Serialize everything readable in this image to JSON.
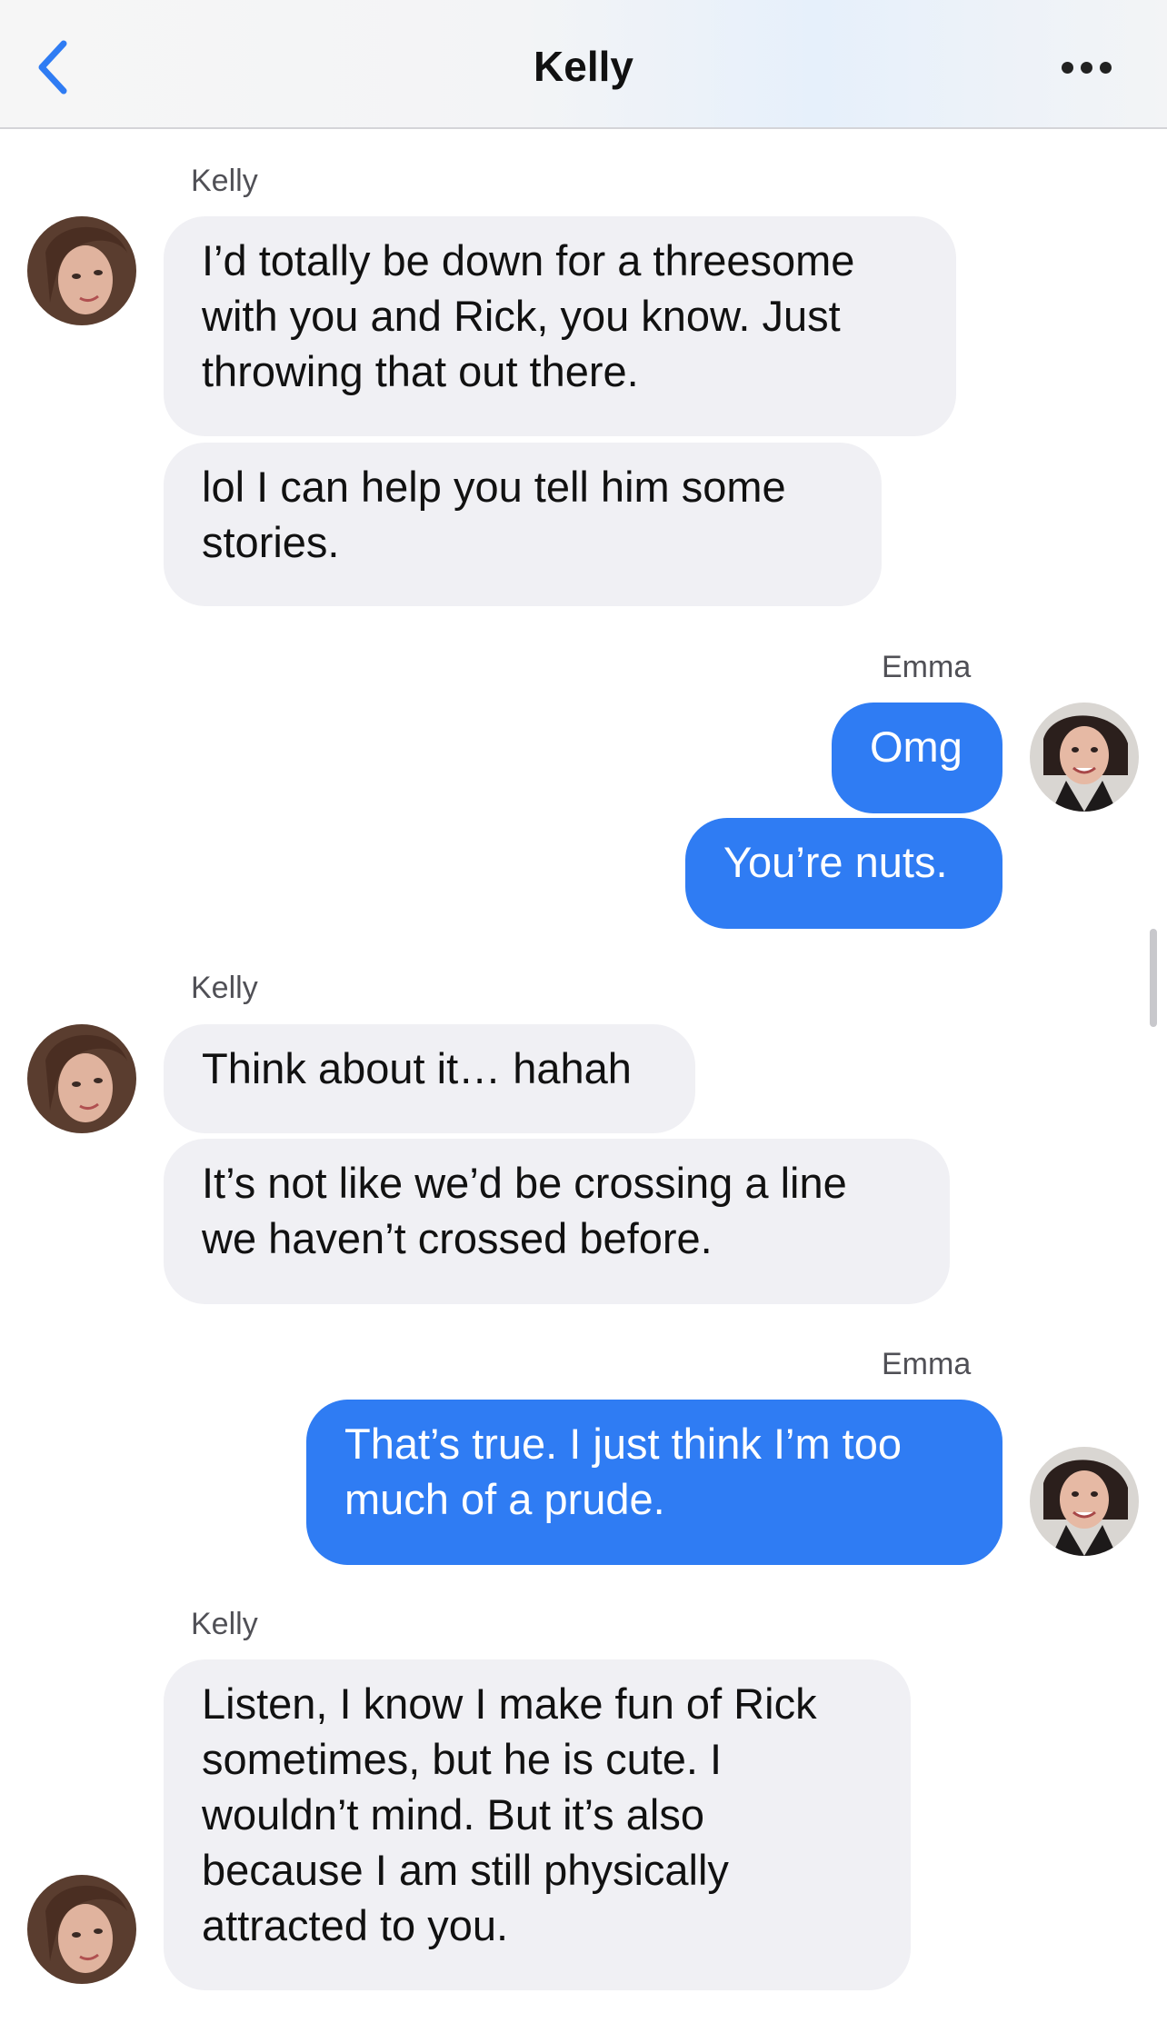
{
  "header": {
    "title": "Kelly"
  },
  "groups": [
    {
      "sender": "Kelly",
      "messages": [
        "I’d totally be down for a threesome with you and Rick, you know. Just throwing that out there.",
        "lol I can help you tell him some stories."
      ]
    },
    {
      "sender": "Emma",
      "messages": [
        "Omg",
        "You’re nuts."
      ]
    },
    {
      "sender": "Kelly",
      "messages": [
        "Think about it… hahah",
        "It’s not like we’d be crossing a line we haven’t crossed before."
      ]
    },
    {
      "sender": "Emma",
      "messages": [
        "That’s true. I just think I’m too much of a prude."
      ]
    },
    {
      "sender": "Kelly",
      "messages": [
        "Listen, I know I make fun of Rick sometimes, but he is cute. I wouldn’t mind. But it’s also because I am still physically attracted to you."
      ]
    }
  ],
  "colors": {
    "outgoing_bubble": "#2f7cf3",
    "incoming_bubble": "#f0f0f4",
    "accent": "#2f7cf3"
  },
  "icons": {
    "back": "chevron-left-icon",
    "more": "ellipsis-icon"
  }
}
